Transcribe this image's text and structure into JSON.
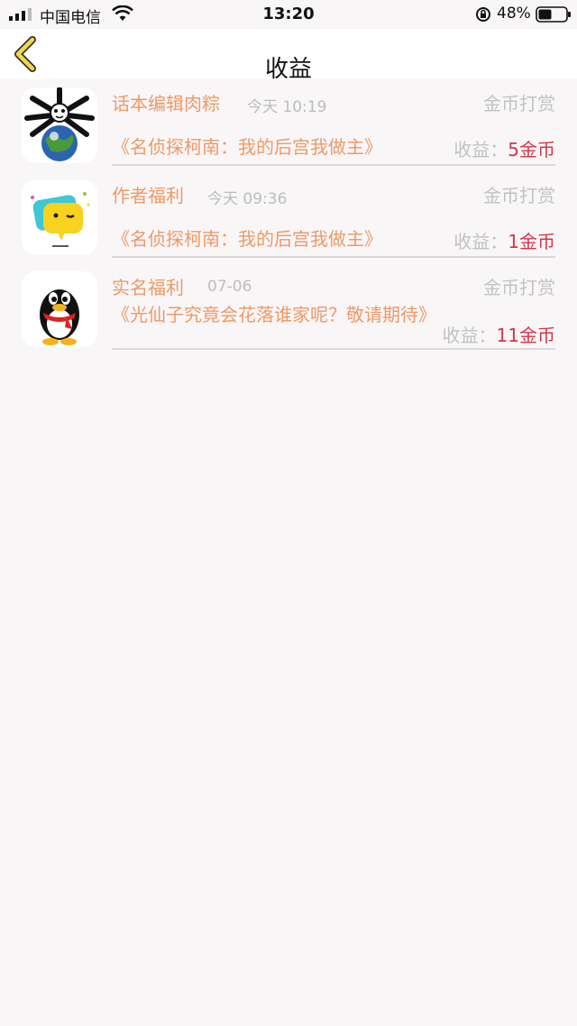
{
  "status_bar": {
    "carrier": "中国电信",
    "time": "13:20",
    "battery_percent": "48%"
  },
  "nav": {
    "title": "收益",
    "back_icon": "chevron-left-icon"
  },
  "colors": {
    "accent": "#ef9966",
    "amount": "#d1364c",
    "muted": "#c2c2c2",
    "back_arrow": "#f2d84a"
  },
  "items": [
    {
      "name": "话本编辑肉粽",
      "date": "今天 10:19",
      "type": "金币打赏",
      "book": "《名侦探柯南：我的后宫我做主》",
      "earn_label": "收益：",
      "earn_amount": "5金币",
      "avatar_icon": "panda-earth-avatar-icon"
    },
    {
      "name": "作者福利",
      "date": "今天 09:36",
      "type": "金币打赏",
      "book": "《名侦探柯南：我的后宫我做主》",
      "earn_label": "收益：",
      "earn_amount": "1金币",
      "avatar_icon": "chat-bubble-avatar-icon"
    },
    {
      "name": "实名福利",
      "date": "07-06",
      "type": "金币打赏",
      "book": "《光仙子究竟会花落谁家呢？敬请期待》",
      "earn_label": "收益：",
      "earn_amount": "11金币",
      "avatar_icon": "qq-penguin-avatar-icon"
    }
  ]
}
